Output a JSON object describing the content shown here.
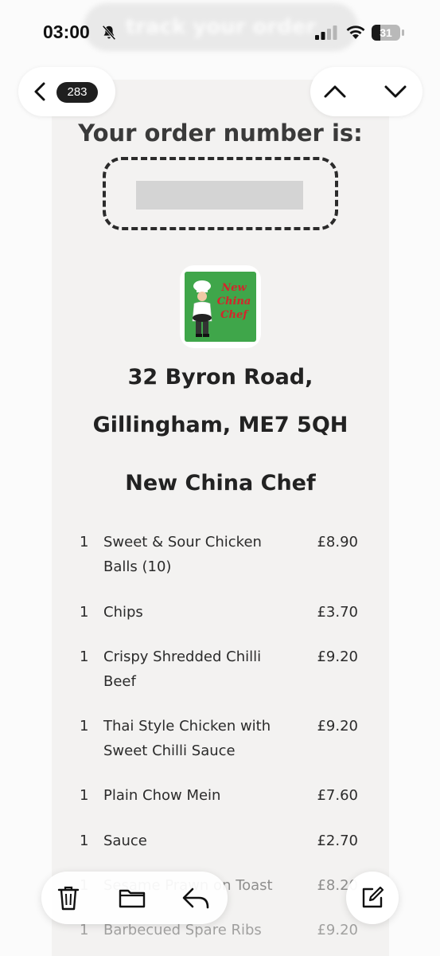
{
  "status_bar": {
    "time": "03:00",
    "battery_level": "31",
    "battery_fraction": 0.31,
    "icons": [
      "bell-slash-icon",
      "signal-icon",
      "wifi-icon",
      "battery-icon"
    ]
  },
  "banner": {
    "text": "track your order"
  },
  "nav": {
    "back_icon": "chevron-left-icon",
    "message_count": "283",
    "up_icon": "chevron-up-icon",
    "down_icon": "chevron-down-icon"
  },
  "email": {
    "order_heading": "Your order number is:",
    "logo_text": "New China Chef",
    "address_line1": "32 Byron Road,",
    "address_line2": "Gillingham, ME7 5QH",
    "restaurant_name": "New China Chef",
    "items": [
      {
        "qty": "1",
        "name": "Sweet & Sour Chicken Balls (10)",
        "price": "£8.90"
      },
      {
        "qty": "1",
        "name": "Chips",
        "price": "£3.70"
      },
      {
        "qty": "1",
        "name": "Crispy Shredded Chilli Beef",
        "price": "£9.20"
      },
      {
        "qty": "1",
        "name": "Thai Style Chicken with Sweet Chilli Sauce",
        "price": "£9.20"
      },
      {
        "qty": "1",
        "name": "Plain Chow Mein",
        "price": "£7.60"
      },
      {
        "qty": "1",
        "name": "Sauce",
        "price": "£2.70"
      },
      {
        "qty": "1",
        "name": "Sesame Prawn on Toast",
        "price": "£8.20"
      },
      {
        "qty": "1",
        "name": "Barbecued Spare Ribs",
        "price": "£9.20"
      }
    ]
  },
  "toolbar": {
    "icons": [
      "trash-icon",
      "folder-icon",
      "reply-icon",
      "compose-icon"
    ]
  },
  "colors": {
    "receipt_bg": "#f3f2f1",
    "logo_green": "#3fa64a",
    "logo_red": "#d4262b",
    "text": "#222222"
  }
}
